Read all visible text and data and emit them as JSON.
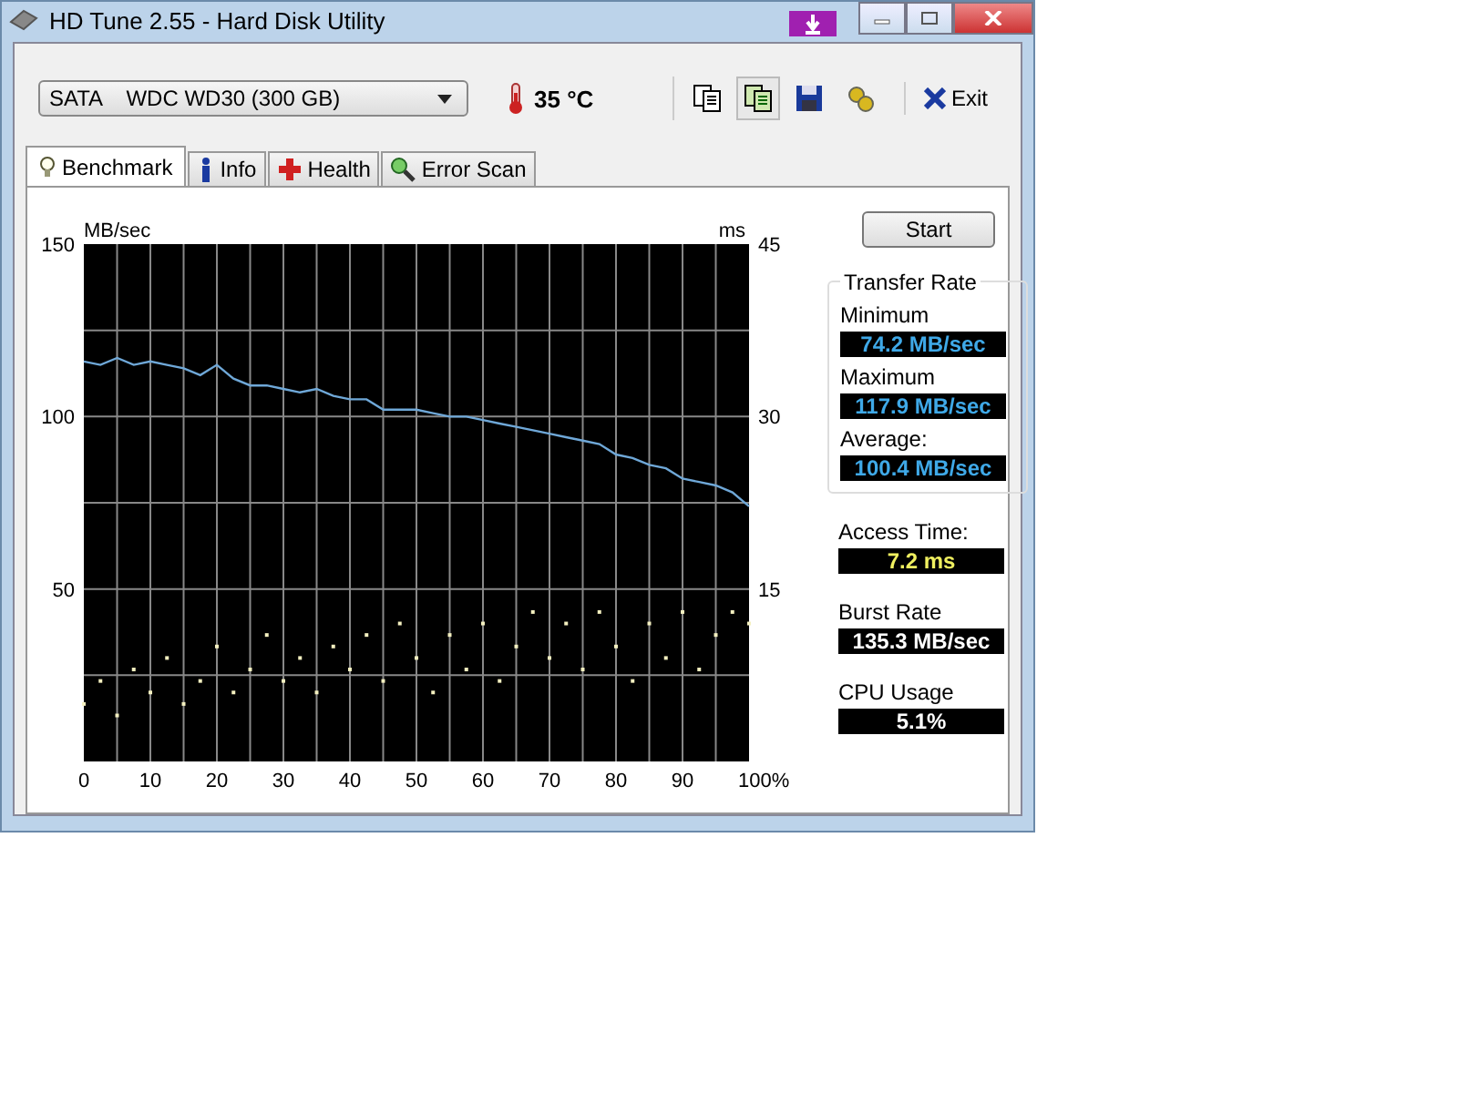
{
  "window": {
    "title": "HD Tune 2.55 - Hard Disk Utility"
  },
  "toolbar": {
    "drive": "SATA    WDC WD30 (300 GB)",
    "temperature": "35 °C",
    "exit": "Exit"
  },
  "tabs": [
    {
      "label": "Benchmark",
      "selected": true
    },
    {
      "label": "Info",
      "selected": false
    },
    {
      "label": "Health",
      "selected": false
    },
    {
      "label": "Error Scan",
      "selected": false
    }
  ],
  "benchmark": {
    "chart_data": {
      "type": "line",
      "ylabel": "MB/sec",
      "grid": true,
      "xlim": [
        0,
        100
      ],
      "ylim": [
        0,
        150
      ],
      "xticks": [
        0,
        10,
        20,
        30,
        40,
        50,
        60,
        70,
        80,
        90,
        {
          "value": 100,
          "label": "100%"
        }
      ],
      "yticks": [
        50,
        100,
        150
      ],
      "x": [
        0,
        2.5,
        5,
        7.5,
        10,
        12.5,
        15,
        17.5,
        20,
        22.5,
        25,
        27.5,
        30,
        32.5,
        35,
        37.5,
        40,
        42.5,
        45,
        47.5,
        50,
        52.5,
        55,
        57.5,
        60,
        62.5,
        65,
        67.5,
        70,
        72.5,
        75,
        77.5,
        80,
        82.5,
        85,
        87.5,
        90,
        92.5,
        95,
        97.5,
        100
      ],
      "series": [
        {
          "color": "#6fa8d8",
          "values": [
            116,
            115,
            117,
            115,
            116,
            115,
            114,
            112,
            115,
            111,
            109,
            109,
            108,
            107,
            108,
            106,
            105,
            105,
            102,
            102,
            102,
            101,
            100,
            100,
            99,
            98,
            97,
            96,
            95,
            94,
            93,
            92,
            89,
            88,
            86,
            85,
            82,
            81,
            80,
            78,
            74
          ]
        }
      ]
    },
    "access_chart": {
      "chart_data": {
        "type": "scatter",
        "ylabel": "ms",
        "ylim": [
          0,
          45
        ],
        "xlim": [
          0,
          100
        ],
        "yticks": [
          15,
          30,
          45
        ],
        "x": [
          0,
          2.5,
          5,
          7.5,
          10,
          12.5,
          15,
          17.5,
          20,
          22.5,
          25,
          27.5,
          30,
          32.5,
          35,
          37.5,
          40,
          42.5,
          45,
          47.5,
          50,
          52.5,
          55,
          57.5,
          60,
          62.5,
          65,
          67.5,
          70,
          72.5,
          75,
          77.5,
          80,
          82.5,
          85,
          87.5,
          90,
          92.5,
          95,
          97.5,
          100
        ],
        "series": [
          {
            "color": "#f4f0c0",
            "values": [
              5,
              7,
              4,
              8,
              6,
              9,
              5,
              7,
              10,
              6,
              8,
              11,
              7,
              9,
              6,
              10,
              8,
              11,
              7,
              12,
              9,
              6,
              11,
              8,
              12,
              7,
              10,
              13,
              9,
              12,
              8,
              13,
              10,
              7,
              12,
              9,
              13,
              8,
              11,
              13,
              12
            ]
          }
        ]
      }
    }
  },
  "start_button": "Start",
  "transfer_rate": {
    "title": "Transfer Rate",
    "readings": [
      {
        "label": "Minimum",
        "value": "74.2 MB/sec",
        "kind": "transfer"
      },
      {
        "label": "Maximum",
        "value": "117.9 MB/sec",
        "kind": "transfer"
      },
      {
        "label": "Average:",
        "value": "100.4 MB/sec",
        "kind": "transfer"
      }
    ]
  },
  "stats": [
    {
      "label": "Access Time:",
      "value": "7.2 ms",
      "kind": "access"
    },
    {
      "label": "Burst Rate",
      "value": "135.3 MB/sec",
      "kind": "plain"
    },
    {
      "label": "CPU Usage",
      "value": "5.1%",
      "kind": "plain"
    }
  ]
}
